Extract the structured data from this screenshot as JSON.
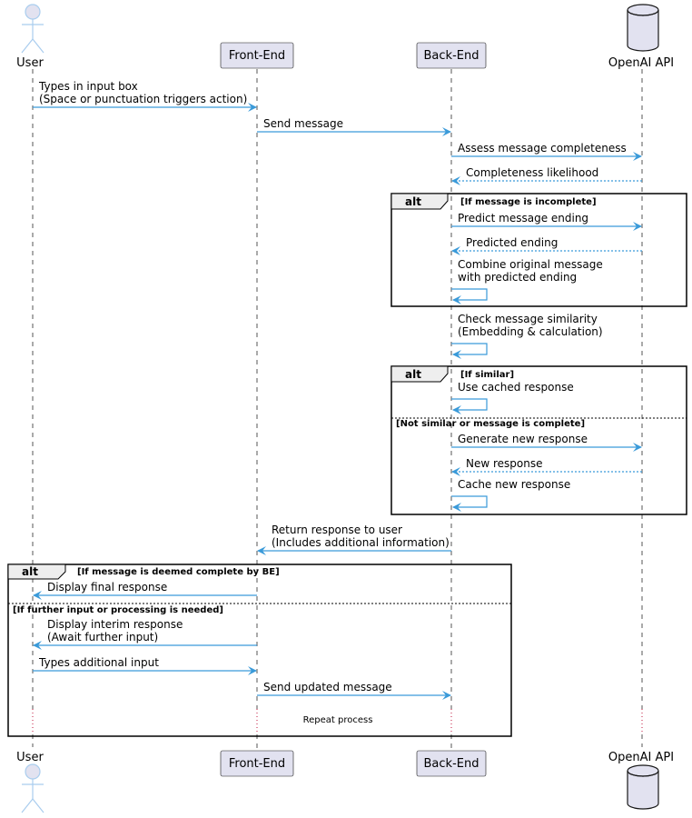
{
  "diagram": {
    "type": "sequence",
    "colors": {
      "arrow": "#3a9ad9",
      "participant_fill": "#e2e2f0",
      "participant_border": "#181818",
      "actor_stroke": "#a9cdee",
      "lifeline": "#555555",
      "delay_lifeline": "#c0143c",
      "alt_header_fill": "#eeeeee"
    },
    "participants": [
      {
        "id": "user",
        "label": "User",
        "kind": "actor"
      },
      {
        "id": "fe",
        "label": "Front-End",
        "kind": "participant"
      },
      {
        "id": "be",
        "label": "Back-End",
        "kind": "participant"
      },
      {
        "id": "api",
        "label": "OpenAI API",
        "kind": "database"
      }
    ],
    "messages": [
      {
        "from": "user",
        "to": "fe",
        "style": "solid",
        "lines": [
          "Types in input box",
          "(Space or punctuation triggers action)"
        ]
      },
      {
        "from": "fe",
        "to": "be",
        "style": "solid",
        "lines": [
          "Send message"
        ]
      },
      {
        "from": "be",
        "to": "api",
        "style": "solid",
        "lines": [
          "Assess message completeness"
        ]
      },
      {
        "from": "api",
        "to": "be",
        "style": "dotted",
        "lines": [
          "Completeness likelihood"
        ]
      },
      {
        "from": "be",
        "to": "api",
        "style": "solid",
        "lines": [
          "Predict message ending"
        ]
      },
      {
        "from": "api",
        "to": "be",
        "style": "dotted",
        "lines": [
          "Predicted ending"
        ]
      },
      {
        "from": "be",
        "to": "be",
        "style": "self",
        "lines": [
          "Combine original message",
          "with predicted ending"
        ]
      },
      {
        "from": "be",
        "to": "be",
        "style": "self",
        "lines": [
          "Check message similarity",
          "(Embedding & calculation)"
        ]
      },
      {
        "from": "be",
        "to": "be",
        "style": "self",
        "lines": [
          "Use cached response"
        ]
      },
      {
        "from": "be",
        "to": "api",
        "style": "solid",
        "lines": [
          "Generate new response"
        ]
      },
      {
        "from": "api",
        "to": "be",
        "style": "dotted",
        "lines": [
          "New response"
        ]
      },
      {
        "from": "be",
        "to": "be",
        "style": "self",
        "lines": [
          "Cache new response"
        ]
      },
      {
        "from": "be",
        "to": "fe",
        "style": "solid",
        "lines": [
          "Return response to user",
          "(Includes additional information)"
        ]
      },
      {
        "from": "fe",
        "to": "user",
        "style": "solid",
        "lines": [
          "Display final response"
        ]
      },
      {
        "from": "fe",
        "to": "user",
        "style": "solid",
        "lines": [
          "Display interim response",
          "(Await further input)"
        ]
      },
      {
        "from": "user",
        "to": "fe",
        "style": "solid",
        "lines": [
          "Types additional input"
        ]
      },
      {
        "from": "fe",
        "to": "be",
        "style": "solid",
        "lines": [
          "Send updated message"
        ]
      }
    ],
    "fragments": [
      {
        "kind": "alt",
        "label": "alt",
        "guards": [
          "[If message is incomplete]"
        ]
      },
      {
        "kind": "alt",
        "label": "alt",
        "guards": [
          "[If similar]",
          "[Not similar or message is complete]"
        ]
      },
      {
        "kind": "alt",
        "label": "alt",
        "guards": [
          "[If message is deemed complete by BE]",
          "[If further input or processing is needed]"
        ]
      }
    ],
    "delay": {
      "label": "Repeat process"
    }
  }
}
